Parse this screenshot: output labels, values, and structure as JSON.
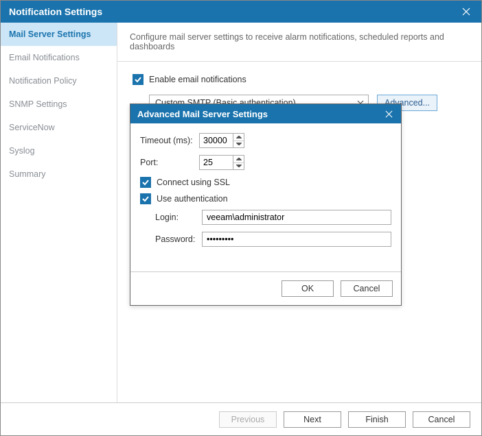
{
  "titlebar": {
    "title": "Notification Settings"
  },
  "sidebar": {
    "items": [
      {
        "label": "Mail Server Settings",
        "active": true
      },
      {
        "label": "Email Notifications"
      },
      {
        "label": "Notification Policy"
      },
      {
        "label": "SNMP Settings"
      },
      {
        "label": "ServiceNow"
      },
      {
        "label": "Syslog"
      },
      {
        "label": "Summary"
      }
    ]
  },
  "main": {
    "description": "Configure mail server settings to receive alarm notifications, scheduled reports and dashboards",
    "enable_label": "Enable email notifications",
    "smtp_select": "Custom SMTP (Basic authentication)",
    "advanced_button": "Advanced..."
  },
  "advanced": {
    "title": "Advanced Mail Server Settings",
    "timeout_label": "Timeout (ms):",
    "timeout_value": "30000",
    "port_label": "Port:",
    "port_value": "25",
    "ssl_label": "Connect using SSL",
    "auth_label": "Use authentication",
    "login_label": "Login:",
    "login_value": "veeam\\administrator",
    "password_label": "Password:",
    "password_value": "•••••••••",
    "ok": "OK",
    "cancel": "Cancel"
  },
  "footer": {
    "previous": "Previous",
    "next": "Next",
    "finish": "Finish",
    "cancel": "Cancel"
  }
}
